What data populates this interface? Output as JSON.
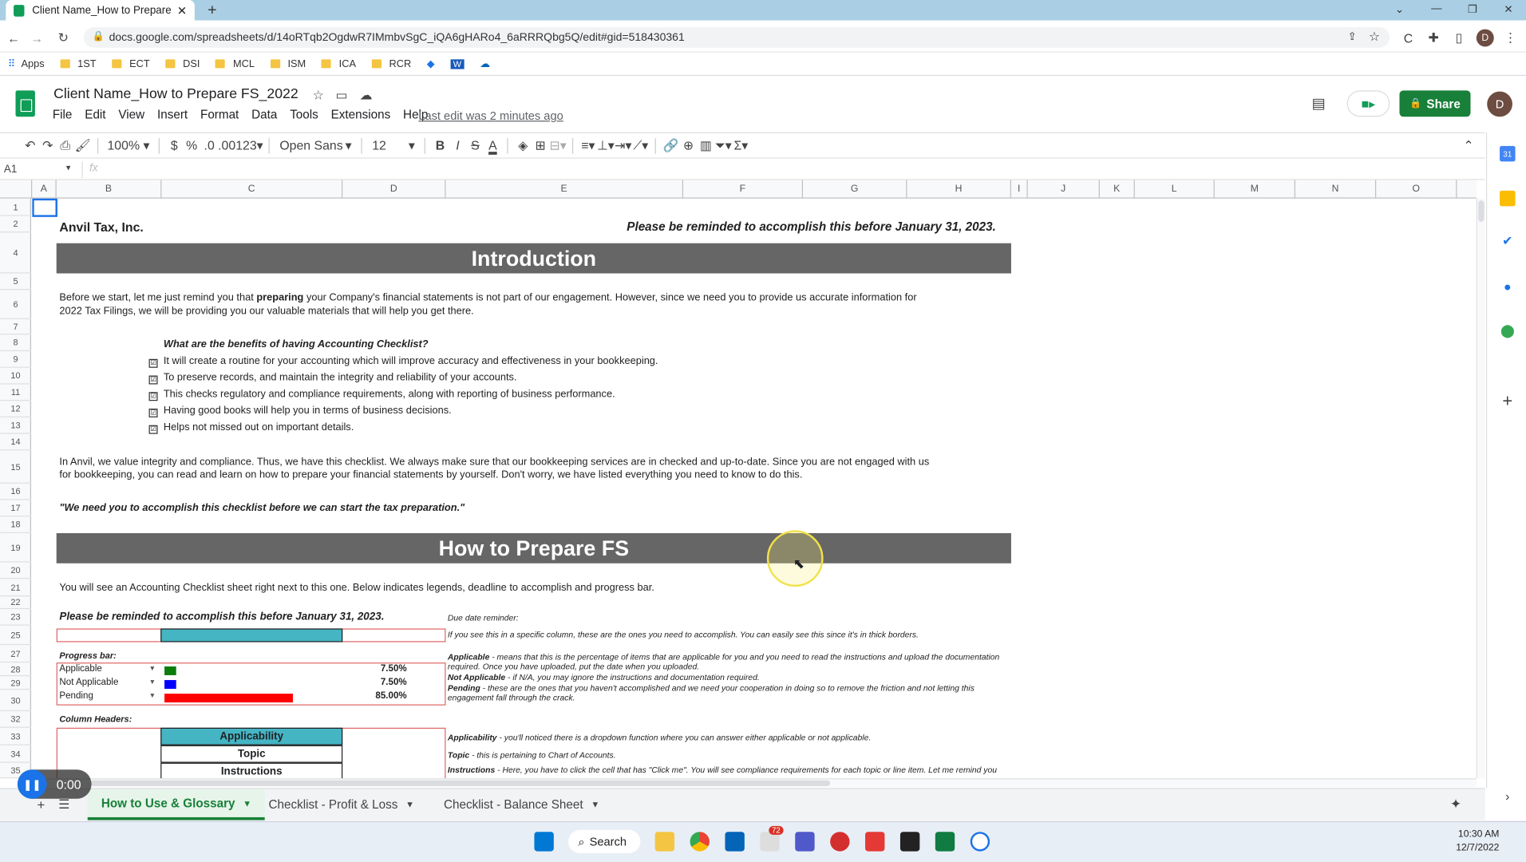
{
  "browser": {
    "tab_title": "Client Name_How to Prepare FS_",
    "url": "docs.google.com/spreadsheets/d/14oRTqb2OgdwR7IMmbvSgC_iQA6gHARo4_6aRRRQbg5Q/edit#gid=518430361",
    "bookmarks": [
      "Apps",
      "1ST",
      "ECT",
      "DSI",
      "MCL",
      "ISM",
      "ICA",
      "RCR"
    ]
  },
  "doc": {
    "title": "Client Name_How to Prepare FS_2022",
    "menus": [
      "File",
      "Edit",
      "View",
      "Insert",
      "Format",
      "Data",
      "Tools",
      "Extensions",
      "Help"
    ],
    "last_edit": "Last edit was 2 minutes ago",
    "share": "Share",
    "avatar": "D"
  },
  "toolbar": {
    "zoom": "100%",
    "currency": "$",
    "percent": "%",
    "dec_less": ".0",
    "dec_more": ".00",
    "more_formats": "123",
    "font": "Open Sans",
    "font_size": "12",
    "bold": "B",
    "italic": "I",
    "strike": "S",
    "text_color": "A"
  },
  "formula": {
    "cell_ref": "A1",
    "fx": "fx"
  },
  "columns": [
    "A",
    "B",
    "C",
    "D",
    "E",
    "F",
    "G",
    "H",
    "I",
    "J",
    "K",
    "L",
    "M",
    "N",
    "O"
  ],
  "rows": [
    "1",
    "2",
    "4",
    "5",
    "6",
    "7",
    "8",
    "9",
    "10",
    "11",
    "12",
    "13",
    "14",
    "15",
    "16",
    "17",
    "18",
    "19",
    "20",
    "21",
    "22",
    "23",
    "25",
    "27",
    "28",
    "29",
    "30",
    "32",
    "33",
    "34",
    "35"
  ],
  "sheet": {
    "company": "Anvil Tax, Inc.",
    "reminder_top": "Please be reminded to accomplish this before January 31, 2023.",
    "intro_band": "Introduction",
    "intro_p1a": "Before we start, let me just remind you that ",
    "intro_p1b": "preparing",
    "intro_p1c": " your Company's financial statements is not part of our engagement. However, since we need you to provide us accurate information for",
    "intro_p1d": "2022 Tax Filings, we will be providing you our valuable materials that will help you get there.",
    "benefits_title": "What are the benefits of having Accounting Checklist?",
    "benefits": [
      "It will create a routine for your accounting which will improve accuracy and effectiveness in your bookkeeping.",
      "To preserve records, and maintain the integrity and reliability of your accounts.",
      "This checks regulatory and compliance requirements, along with reporting of business performance.",
      "Having good books will help you in terms of business decisions.",
      "Helps not missed out on important details."
    ],
    "check_glyph": "☑",
    "intro_p2a": "In Anvil, we value integrity and compliance. Thus, we have this checklist. We always make sure that our bookkeeping services are in checked and up-to-date. Since you are not engaged with us",
    "intro_p2b": "for bookkeeping, you can read and learn on how to prepare your financial statements by yourself. Don't worry, we have listed everything you need to know to do this.",
    "quote": "\"We need you to accomplish this checklist before we can start the tax preparation.\"",
    "howto_band": "How to Prepare FS",
    "howto_p": "You will see an Accounting Checklist sheet right next to this one. Below indicates legends, deadline to accomplish and progress bar.",
    "reminder_bottom": "Please be reminded to accomplish this before January 31, 2023.",
    "due_note": "Due date reminder:",
    "border_note": "If you see this in a specific column, these are the ones you need to accomplish. You can easily see this since it's in thick borders.",
    "progress_title": "Progress bar:",
    "progress": [
      {
        "label": "Applicable",
        "pct": "7.50%",
        "value": 7.5,
        "color": "#0b7d0b"
      },
      {
        "label": "Not Applicable",
        "pct": "7.50%",
        "value": 7.5,
        "color": "#0000ff"
      },
      {
        "label": "Pending",
        "pct": "85.00%",
        "value": 85,
        "color": "#ff0000"
      }
    ],
    "applicable_b": "Applicable",
    "applicable_t": " - means that this is the percentage of items that are applicable for you and you need to read the instructions and upload the documentation required. Once you have uploaded, put the date when you uploaded.",
    "notapp_b": "Not Applicable",
    "notapp_t": " - if N/A, you may ignore the instructions and documentation required.",
    "pending_b": "Pending",
    "pending_t": " - these are the ones that you haven't accomplished and we need your cooperation in doing so to remove the friction and not letting this engagement fall through the crack.",
    "col_headers_title": "Column Headers:",
    "hdr_applicability": "Applicability",
    "hdr_topic": "Topic",
    "hdr_instructions": "Instructions",
    "applicability_b": "Applicability",
    "applicability_t": " - you'll noticed there is a dropdown function where you can answer either applicable or not applicable.",
    "topic_b": "Topic",
    "topic_t": " - this is pertaining to Chart of Accounts.",
    "instr_b": "Instructions",
    "instr_t": " - Here, you have to click the cell that has \"Click me\". You will see compliance requirements for each topic or line item. Let me remind you"
  },
  "sheet_tabs": [
    "How to Use & Glossary",
    "Checklist - Profit & Loss",
    "Checklist - Balance Sheet"
  ],
  "video": {
    "time": "0:00"
  },
  "taskbar": {
    "search": "Search",
    "badge": "72",
    "time": "10:30 AM",
    "date": "12/7/2022"
  },
  "colors": {
    "accent_green": "#188038",
    "band_gray": "#666666",
    "teal": "#45b5c4"
  }
}
